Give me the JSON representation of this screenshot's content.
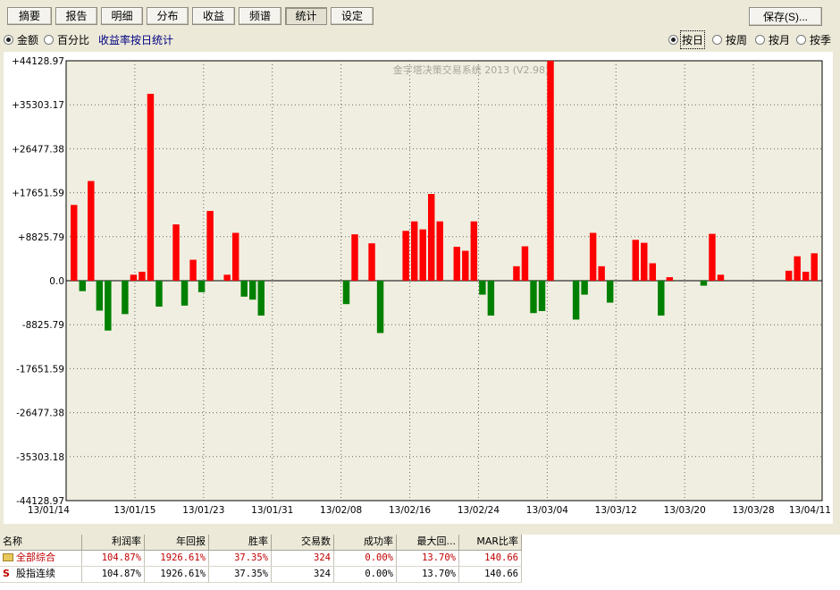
{
  "toolbar": {
    "tabs": [
      {
        "label": "摘要"
      },
      {
        "label": "报告"
      },
      {
        "label": "明细"
      },
      {
        "label": "分布"
      },
      {
        "label": "收益"
      },
      {
        "label": "频谱"
      },
      {
        "label": "统计",
        "active": true
      },
      {
        "label": "设定"
      }
    ],
    "save_label": "保存(S)..."
  },
  "options": {
    "mode_amount": "金额",
    "mode_percent": "百分比",
    "stat_link": "收益率按日统计",
    "period_day": "按日",
    "period_week": "按周",
    "period_month": "按月",
    "period_quarter": "按季"
  },
  "chart_data": {
    "type": "bar",
    "watermark": "金字塔决策交易系统 2013 (V2.98)",
    "ylim": [
      -44128.97,
      44128.97
    ],
    "y_ticks": [
      "+44128.97",
      "+35303.17",
      "+26477.38",
      "+17651.59",
      "+8825.79",
      "0.0",
      "-8825.79",
      "-17651.59",
      "-26477.38",
      "-35303.18",
      "-44128.97"
    ],
    "x_ticks": [
      "13/01/14",
      "13/01/15",
      "13/01/23",
      "13/01/31",
      "13/02/08",
      "13/02/16",
      "13/02/24",
      "13/03/04",
      "13/03/12",
      "13/03/20",
      "13/03/28",
      "13/04/11"
    ],
    "grid": true,
    "positive_color": "#ff0000",
    "negative_color": "#008000",
    "values": [
      15200,
      -2100,
      20000,
      -6000,
      -10000,
      0,
      -6700,
      1200,
      1800,
      37500,
      -5200,
      0,
      11300,
      -5000,
      4200,
      -2300,
      14000,
      0,
      1200,
      9600,
      -3200,
      -3800,
      -7000,
      0,
      0,
      0,
      0,
      0,
      0,
      0,
      0,
      0,
      -4700,
      9300,
      0,
      7500,
      -10500,
      0,
      0,
      10000,
      11900,
      10300,
      17400,
      11900,
      0,
      6800,
      6000,
      11900,
      -2800,
      -7000,
      0,
      0,
      2900,
      6900,
      -6500,
      -6100,
      44128.97,
      0,
      0,
      -7800,
      -2800,
      9600,
      2900,
      -4400,
      0,
      0,
      8200,
      7600,
      3500,
      -7000,
      700,
      0,
      0,
      0,
      -1000,
      9400,
      1200,
      0,
      0,
      0,
      0,
      0,
      0,
      0,
      2000,
      4900,
      1800,
      5500
    ]
  },
  "table": {
    "headers": [
      "名称",
      "利润率",
      "年回报",
      "胜率",
      "交易数",
      "成功率",
      "最大回...",
      "MAR比率"
    ],
    "rows": [
      {
        "icon": "folder-icon",
        "cells": [
          "全部综合",
          "104.87%",
          "1926.61%",
          "37.35%",
          "324",
          "0.00%",
          "13.70%",
          "140.66"
        ]
      },
      {
        "icon": "s-icon",
        "icon_text": "S",
        "cells": [
          "股指连续",
          "104.87%",
          "1926.61%",
          "37.35%",
          "324",
          "0.00%",
          "13.70%",
          "140.66"
        ]
      }
    ]
  }
}
